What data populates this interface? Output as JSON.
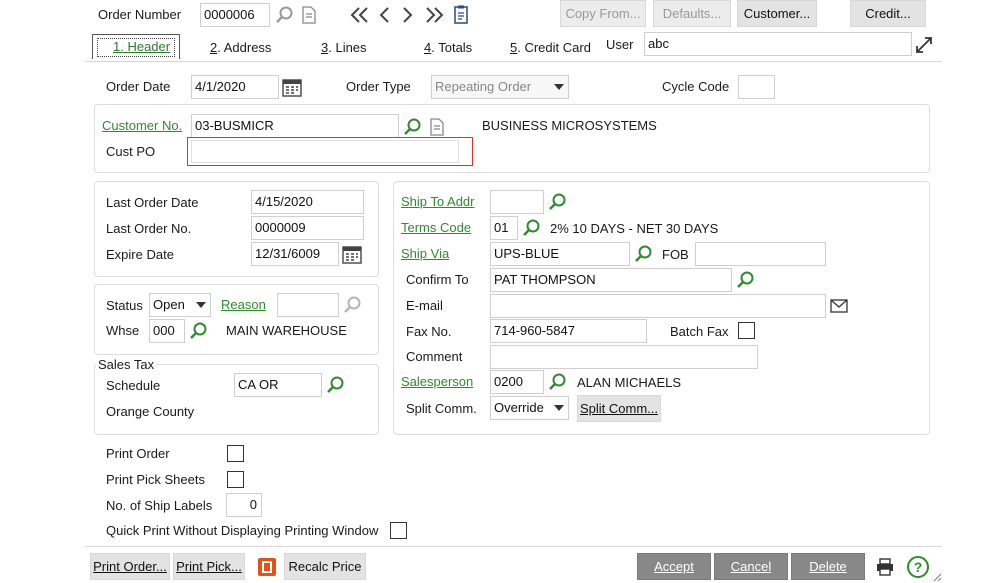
{
  "toolbar": {
    "order_number_label": "Order Number",
    "order_number_value": "0000006",
    "copy_from": "Copy From...",
    "defaults": "Defaults...",
    "customer": "Customer...",
    "credit": "Credit..."
  },
  "tabs": [
    {
      "num": "1.",
      "label": " Header"
    },
    {
      "num": "2",
      "label": ". Address"
    },
    {
      "num": "3",
      "label": ". Lines"
    },
    {
      "num": "4",
      "label": ". Totals"
    },
    {
      "num": "5",
      "label": ". Credit Card"
    }
  ],
  "user": {
    "label": "User",
    "value": "abc"
  },
  "header": {
    "order_date_label": "Order Date",
    "order_date": "4/1/2020",
    "order_type_label": "Order Type",
    "order_type": "Repeating Order",
    "cycle_code_label": "Cycle Code",
    "cycle_code": ""
  },
  "customer": {
    "customer_no_label": "Customer No.",
    "customer_no": "03-BUSMICR",
    "customer_name": "BUSINESS MICROSYSTEMS",
    "cust_po_label": "Cust PO",
    "cust_po": ""
  },
  "history": {
    "last_order_date_label": "Last Order Date",
    "last_order_date": "4/15/2020",
    "last_order_no_label": "Last Order No.",
    "last_order_no": "0000009",
    "expire_date_label": "Expire Date",
    "expire_date": "12/31/6009"
  },
  "status": {
    "status_label": "Status",
    "status_value": "Open",
    "reason_label": "Reason",
    "reason_value": "",
    "whse_label": "Whse",
    "whse_value": "000",
    "whse_name": "MAIN WAREHOUSE"
  },
  "sales_tax": {
    "title": "Sales Tax",
    "schedule_label": "Schedule",
    "schedule_value": "CA OR",
    "schedule_desc": "Orange County"
  },
  "shipping": {
    "ship_to_label": "Ship To Addr",
    "ship_to_value": "",
    "terms_label": "Terms Code",
    "terms_value": "01",
    "terms_desc": "2% 10 DAYS - NET 30 DAYS",
    "ship_via_label": "Ship Via",
    "ship_via_value": "UPS-BLUE",
    "fob_label": "FOB",
    "fob_value": "",
    "confirm_label": "Confirm To",
    "confirm_value": "PAT THOMPSON",
    "email_label": "E-mail",
    "email_value": "",
    "fax_label": "Fax No.",
    "fax_value": "714-960-5847",
    "batch_fax_label": "Batch Fax",
    "comment_label": "Comment",
    "comment_value": "",
    "salesperson_label": "Salesperson",
    "salesperson_value": "0200",
    "salesperson_name": "ALAN MICHAELS",
    "split_label": "Split Comm.",
    "split_value": "Override",
    "split_button": "Split Comm..."
  },
  "print": {
    "print_order_label": "Print Order",
    "print_pick_label": "Print Pick Sheets",
    "ship_labels_label": "No. of Ship Labels",
    "ship_labels_value": "0",
    "quick_print_label": "Quick Print Without Displaying Printing Window"
  },
  "footer": {
    "print_order": "Print Order...",
    "print_pick": "Print Pick...",
    "recalc": "Recalc Price",
    "accept": "Accept",
    "cancel": "Cancel",
    "delete": "Delete",
    "help": "?"
  }
}
